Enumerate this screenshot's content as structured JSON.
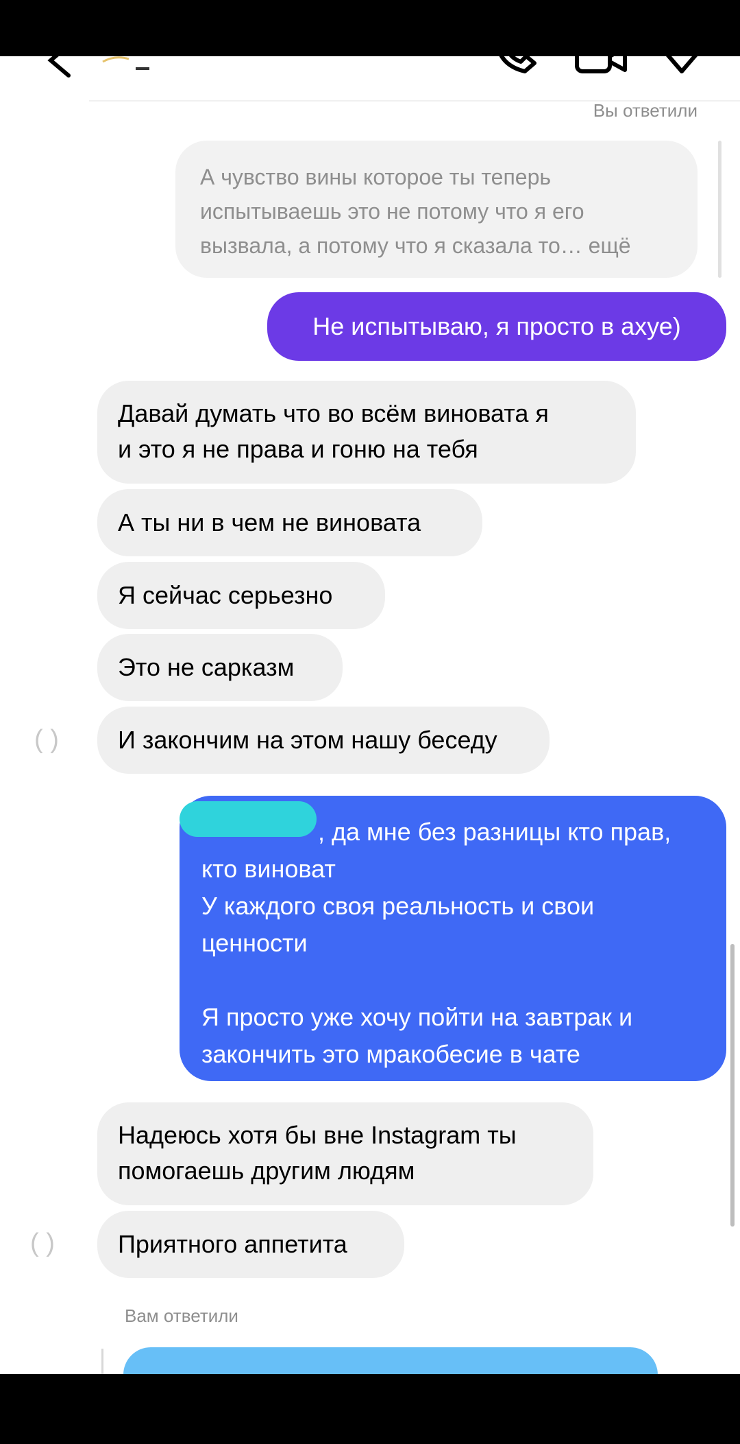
{
  "header": {
    "back_icon": "chevron-left-icon",
    "call_icon": "phone-icon",
    "video_icon": "video-camera-icon",
    "info_icon": "info-icon"
  },
  "reply_labels": {
    "you_replied": "Вы ответили",
    "replied_to_you": "Вам ответили"
  },
  "quoted_message": {
    "text": "А чувство вины которое ты теперь\nиспытываешь это не потому что я его\nвызвала, а потому что я сказала то… ещё"
  },
  "messages": [
    {
      "side": "out",
      "text": "Не испытываю, я просто в ахуе)"
    },
    {
      "side": "in",
      "text": "Давай думать что во всём виновата я\nи это я не права и гоню на тебя"
    },
    {
      "side": "in",
      "text": "А ты ни в чем не виновата"
    },
    {
      "side": "in",
      "text": "Я сейчас серьезно"
    },
    {
      "side": "in",
      "text": "Это не сарказм"
    },
    {
      "side": "in",
      "text": "И закончим на этом нашу беседу"
    },
    {
      "side": "out",
      "lines": [
        ", да мне без разницы кто прав,",
        "кто виноват",
        "У каждого своя реальность и свои",
        "ценности",
        "",
        "Я просто уже хочу пойти на завтрак и",
        "закончить это мракобесие в чате"
      ]
    },
    {
      "side": "in",
      "text": "Надеюсь хотя бы вне Instagram ты\nпомогаешь другим людям"
    },
    {
      "side": "in",
      "text": "Приятного аппетита"
    }
  ],
  "colors": {
    "outgoing_purple": "#6c3ae6",
    "outgoing_blue": "#3f69f5",
    "incoming": "#efefef",
    "reply_quote": "#f2f2f2"
  }
}
